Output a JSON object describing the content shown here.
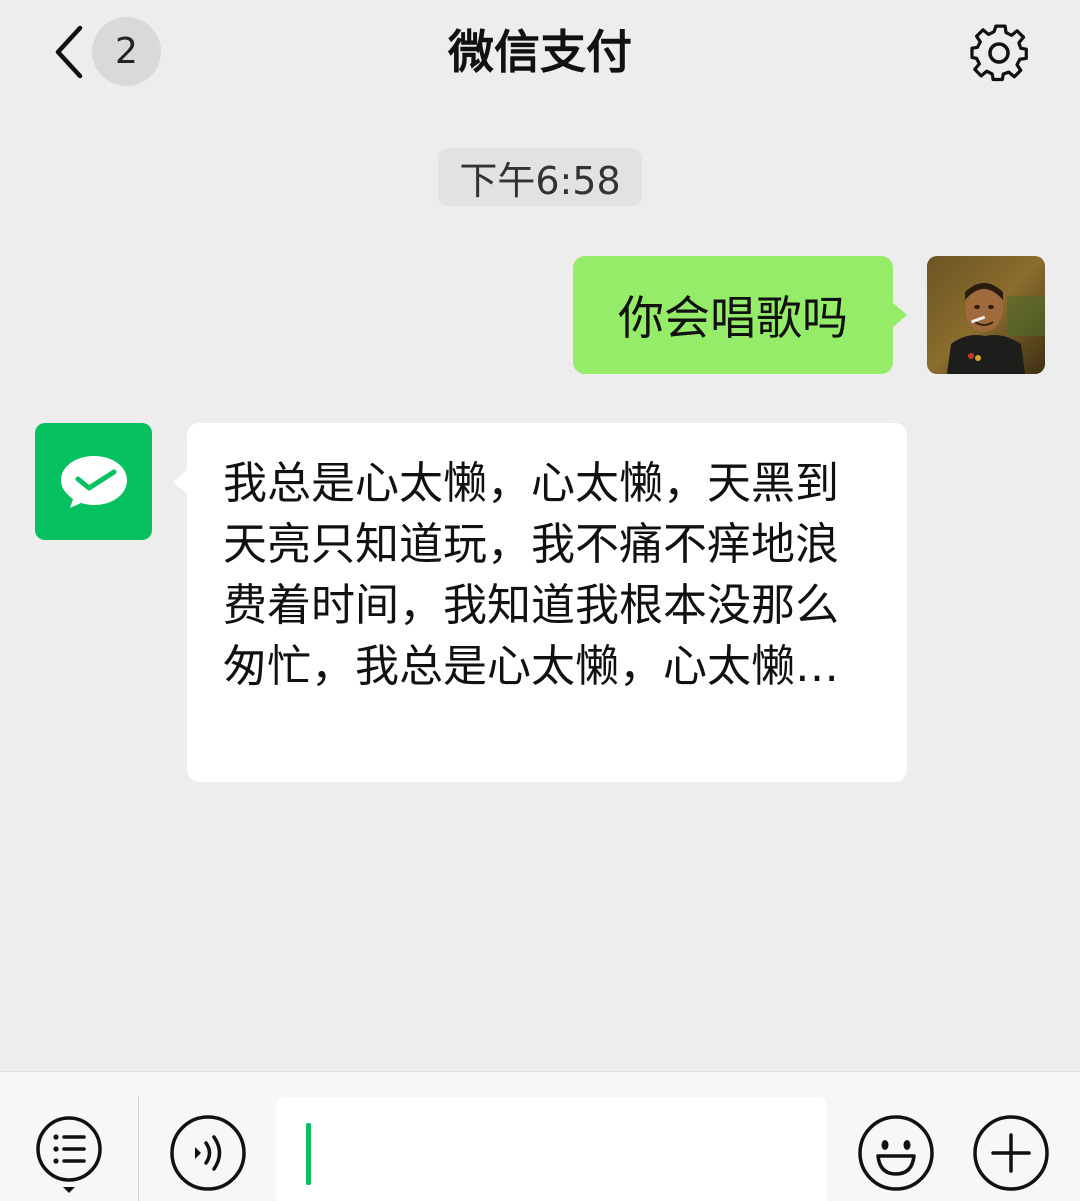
{
  "nav": {
    "title": "微信支付",
    "unread_count": "2",
    "back_icon": "chevron-left-icon",
    "settings_icon": "gear-icon"
  },
  "chat": {
    "timestamp": "下午6:58",
    "messages": [
      {
        "direction": "outgoing",
        "text": "你会唱歌吗"
      },
      {
        "direction": "incoming",
        "sender": "微信支付",
        "text": "我总是心太懒，心太懒，天黑到天亮只知道玩，我不痛不痒地浪费着时间，我知道我根本没那么匆忙，我总是心太懒，心太懒…"
      }
    ]
  },
  "input_bar": {
    "menu_icon": "list-menu-icon",
    "voice_icon": "voice-icon",
    "text_value": "",
    "emoji_icon": "emoji-icon",
    "plus_icon": "plus-icon"
  },
  "colors": {
    "background": "#ededed",
    "outgoing_bubble": "#95ec69",
    "incoming_bubble": "#ffffff",
    "brand_green": "#07c160"
  }
}
